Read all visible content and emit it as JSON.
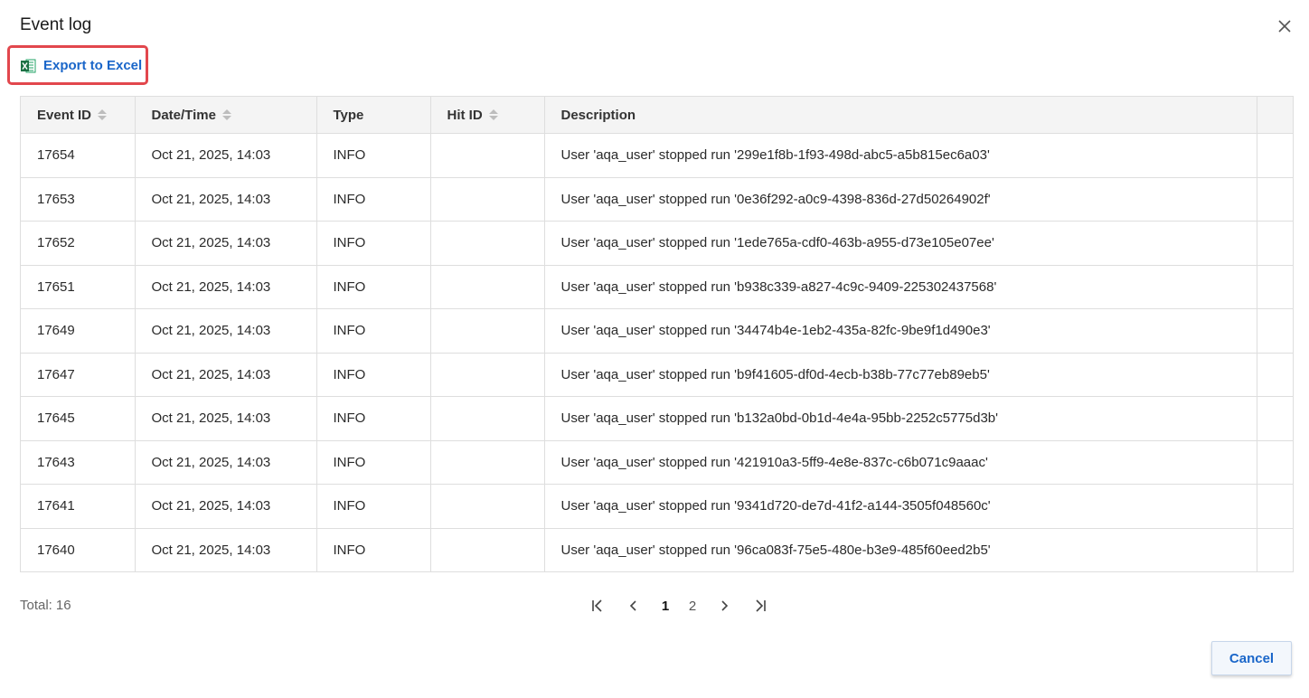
{
  "dialog": {
    "title": "Event log",
    "close_icon": "close-icon"
  },
  "toolbar": {
    "export_label": "Export to Excel",
    "export_icon": "excel-icon",
    "highlight_color": "#e2474d"
  },
  "table": {
    "columns": [
      {
        "label": "Event ID",
        "sortable": true
      },
      {
        "label": "Date/Time",
        "sortable": true
      },
      {
        "label": "Type",
        "sortable": false
      },
      {
        "label": "Hit ID",
        "sortable": true
      },
      {
        "label": "Description",
        "sortable": false
      }
    ],
    "rows": [
      {
        "event_id": "17654",
        "datetime": "Oct 21, 2025, 14:03",
        "type": "INFO",
        "hit_id": "",
        "description": "User 'aqa_user' stopped run '299e1f8b-1f93-498d-abc5-a5b815ec6a03'"
      },
      {
        "event_id": "17653",
        "datetime": "Oct 21, 2025, 14:03",
        "type": "INFO",
        "hit_id": "",
        "description": "User 'aqa_user' stopped run '0e36f292-a0c9-4398-836d-27d50264902f'"
      },
      {
        "event_id": "17652",
        "datetime": "Oct 21, 2025, 14:03",
        "type": "INFO",
        "hit_id": "",
        "description": "User 'aqa_user' stopped run '1ede765a-cdf0-463b-a955-d73e105e07ee'"
      },
      {
        "event_id": "17651",
        "datetime": "Oct 21, 2025, 14:03",
        "type": "INFO",
        "hit_id": "",
        "description": "User 'aqa_user' stopped run 'b938c339-a827-4c9c-9409-225302437568'"
      },
      {
        "event_id": "17649",
        "datetime": "Oct 21, 2025, 14:03",
        "type": "INFO",
        "hit_id": "",
        "description": "User 'aqa_user' stopped run '34474b4e-1eb2-435a-82fc-9be9f1d490e3'"
      },
      {
        "event_id": "17647",
        "datetime": "Oct 21, 2025, 14:03",
        "type": "INFO",
        "hit_id": "",
        "description": "User 'aqa_user' stopped run 'b9f41605-df0d-4ecb-b38b-77c77eb89eb5'"
      },
      {
        "event_id": "17645",
        "datetime": "Oct 21, 2025, 14:03",
        "type": "INFO",
        "hit_id": "",
        "description": "User 'aqa_user' stopped run 'b132a0bd-0b1d-4e4a-95bb-2252c5775d3b'"
      },
      {
        "event_id": "17643",
        "datetime": "Oct 21, 2025, 14:03",
        "type": "INFO",
        "hit_id": "",
        "description": "User 'aqa_user' stopped run '421910a3-5ff9-4e8e-837c-c6b071c9aaac'"
      },
      {
        "event_id": "17641",
        "datetime": "Oct 21, 2025, 14:03",
        "type": "INFO",
        "hit_id": "",
        "description": "User 'aqa_user' stopped run '9341d720-de7d-41f2-a144-3505f048560c'"
      },
      {
        "event_id": "17640",
        "datetime": "Oct 21, 2025, 14:03",
        "type": "INFO",
        "hit_id": "",
        "description": "User 'aqa_user' stopped run '96ca083f-75e5-480e-b3e9-485f60eed2b5'"
      }
    ]
  },
  "footer": {
    "total_label": "Total:",
    "total_value": "16",
    "pagination": {
      "first_icon": "first-page-icon",
      "prev_icon": "chevron-left-icon",
      "pages": [
        "1",
        "2"
      ],
      "current_page": "1",
      "next_icon": "chevron-right-icon",
      "last_icon": "last-page-icon"
    },
    "cancel_label": "Cancel"
  }
}
